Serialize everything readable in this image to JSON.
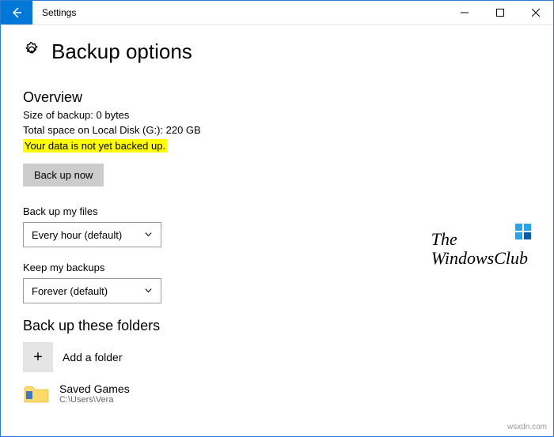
{
  "titlebar": {
    "title": "Settings"
  },
  "page": {
    "title": "Backup options"
  },
  "overview": {
    "heading": "Overview",
    "size_line": "Size of backup: 0 bytes",
    "space_line": "Total space on Local Disk (G:): 220 GB",
    "status_line": "Your data is not yet backed up.",
    "backup_btn": "Back up now"
  },
  "frequency": {
    "label": "Back up my files",
    "value": "Every hour (default)"
  },
  "retention": {
    "label": "Keep my backups",
    "value": "Forever (default)"
  },
  "folders": {
    "heading": "Back up these folders",
    "add_label": "Add a folder",
    "item": {
      "name": "Saved Games",
      "path": "C:\\Users\\Vera"
    }
  },
  "watermark": {
    "line1": "The",
    "line2": "WindowsClub"
  },
  "attrib": "wsxdn.com"
}
